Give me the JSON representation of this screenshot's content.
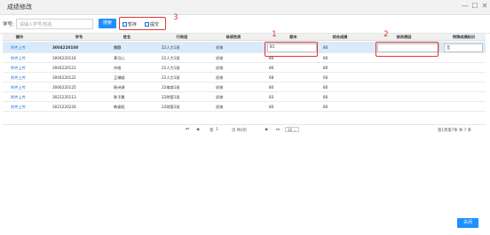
{
  "window": {
    "title": "成绩修改",
    "controls": [
      "—",
      "☐",
      "✕"
    ]
  },
  "search": {
    "label": "学号:",
    "placeholder": "请输入学号/姓名",
    "button": "搜索"
  },
  "toolbar": {
    "save_label": "暂存",
    "submit_label": "提交"
  },
  "annotations": [
    "1",
    "2",
    "3"
  ],
  "table": {
    "headers": [
      "操作",
      "学号",
      "姓名",
      "行政班",
      "修读性质",
      "期末",
      "综合成绩",
      "修改原因",
      "特殊成绩标识"
    ],
    "rows": [
      {
        "action": "附件上传",
        "sid": "3004220108",
        "name": "刘欣",
        "cls": "22人力1班",
        "nature": "初修",
        "final": "81",
        "total": "80",
        "reason": "",
        "flag": "无"
      },
      {
        "action": "附件上传",
        "sid": "3004220118",
        "name": "黄可心",
        "cls": "22人力1班",
        "nature": "初修",
        "final": "80",
        "total": "80",
        "reason": "",
        "flag": ""
      },
      {
        "action": "附件上传",
        "sid": "3004220121",
        "name": "刘皓",
        "cls": "22人力1班",
        "nature": "初修",
        "final": "86",
        "total": "80",
        "reason": "",
        "flag": ""
      },
      {
        "action": "附件上传",
        "sid": "3004220122",
        "name": "王琳颖",
        "cls": "22人力1班",
        "nature": "初修",
        "final": "68",
        "total": "60",
        "reason": "",
        "flag": ""
      },
      {
        "action": "附件上传",
        "sid": "3006220125",
        "name": "杨诗源",
        "cls": "22电商1班",
        "nature": "初修",
        "final": "80",
        "total": "80",
        "reason": "",
        "flag": ""
      },
      {
        "action": "附件上传",
        "sid": "3021220113",
        "name": "陈子晨",
        "cls": "22财管1班",
        "nature": "初修",
        "final": "83",
        "total": "80",
        "reason": "",
        "flag": ""
      },
      {
        "action": "附件上传",
        "sid": "3021220226",
        "name": "韩振銘",
        "cls": "22财管2班",
        "nature": "初修",
        "final": "80",
        "total": "80",
        "reason": "",
        "flag": ""
      }
    ]
  },
  "pager": {
    "first": "⏮",
    "prev": "◀",
    "page_label": "第",
    "page_value": "1",
    "page_suffix": "页  共0页",
    "next": "▶",
    "last": "⏭",
    "size": "10",
    "summary": "第1到第7条   共 7 条"
  },
  "footer": {
    "close_label": "关闭"
  }
}
